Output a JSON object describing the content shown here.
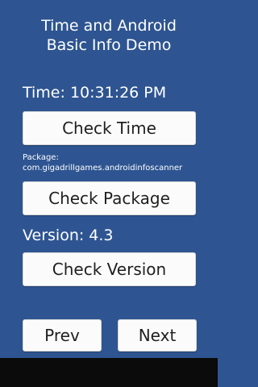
{
  "header": {
    "title_line1": "Time and Android",
    "title_line2": "Basic Info Demo"
  },
  "time": {
    "text": "Time: 10:31:26 PM",
    "button_label": "Check Time"
  },
  "package": {
    "label": "Package:",
    "value": "com.gigadrillgames.androidinfoscanner",
    "button_label": "Check Package"
  },
  "version": {
    "text": "Version: 4.3",
    "button_label": "Check Version"
  },
  "navigation": {
    "prev_label": "Prev",
    "next_label": "Next"
  },
  "colors": {
    "background": "#2e5591",
    "button": "#fbfbfb",
    "text_light": "#ffffff",
    "text_dark": "#1f1f1f"
  }
}
